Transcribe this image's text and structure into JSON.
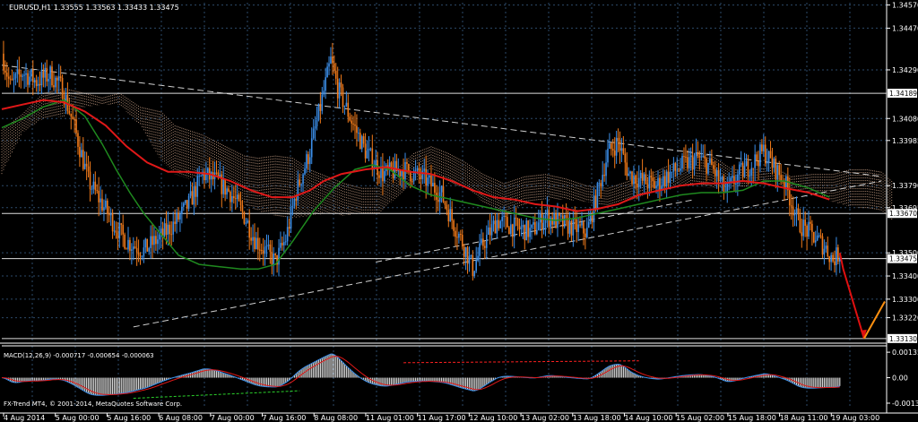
{
  "header": {
    "symbol_line": "EURUSD,H1  1.33555 1.33563 1.33433 1.33475",
    "macd_line": "MACD(12,26,9) -0.000717 -0.000654 -0.000063",
    "copyright": "FX-Trend MT4, © 2001-2014, MetaQuotes Software Corp."
  },
  "colors": {
    "background": "#000000",
    "grid": "#2c4a6a",
    "bull_candle": "#3b8ee8",
    "bear_candle": "#f07a1a",
    "ma_red": "#e01818",
    "ma_green": "#1f8a1f",
    "cloud": "#d2a88c",
    "trendline": "#cfcfcf",
    "forecast_down": "#e01010",
    "forecast_up": "#ff9010"
  },
  "chart_data": {
    "type": "candlestick",
    "symbol": "EURUSD",
    "timeframe": "H1",
    "ohlc_last": {
      "open": 1.33555,
      "high": 1.33563,
      "low": 1.33433,
      "close": 1.33475
    },
    "price_axis": {
      "range": [
        1.3311,
        1.3458
      ],
      "ticks": [
        "1.34570",
        "1.34470",
        "1.34290",
        "1.34080",
        "1.33985",
        "1.33790",
        "1.33695",
        "1.33500",
        "1.33400",
        "1.33300",
        "1.33220"
      ],
      "tick_values": [
        1.3457,
        1.3447,
        1.3429,
        1.3408,
        1.33985,
        1.3379,
        1.33695,
        1.335,
        1.334,
        1.333,
        1.3322
      ]
    },
    "price_labels": [
      {
        "label": "1.34189",
        "value": 1.34189
      },
      {
        "label": "1.33670",
        "value": 1.3367
      },
      {
        "label": "1.33475",
        "value": 1.33475
      },
      {
        "label": "1.33130",
        "value": 1.3313
      }
    ],
    "time_axis": {
      "labels": [
        "4 Aug 2014",
        "5 Aug 00:00",
        "5 Aug 16:00",
        "6 Aug 08:00",
        "7 Aug 00:00",
        "7 Aug 16:00",
        "8 Aug 08:00",
        "11 Aug 01:00",
        "11 Aug 17:00",
        "12 Aug 10:00",
        "13 Aug 02:00",
        "13 Aug 18:00",
        "14 Aug 10:00",
        "15 Aug 02:00",
        "15 Aug 18:00",
        "18 Aug 11:00",
        "19 Aug 03:00"
      ]
    },
    "price_path": [
      [
        0,
        1.3436
      ],
      [
        5,
        1.3422
      ],
      [
        12,
        1.3428
      ],
      [
        20,
        1.3424
      ],
      [
        28,
        1.3427
      ],
      [
        35,
        1.3421
      ],
      [
        42,
        1.3404
      ],
      [
        50,
        1.3381
      ],
      [
        58,
        1.3371
      ],
      [
        66,
        1.3361
      ],
      [
        72,
        1.3355
      ],
      [
        82,
        1.3351
      ],
      [
        92,
        1.3357
      ],
      [
        100,
        1.3363
      ],
      [
        108,
        1.3371
      ],
      [
        116,
        1.3384
      ],
      [
        124,
        1.3381
      ],
      [
        132,
        1.3376
      ],
      [
        140,
        1.3366
      ],
      [
        146,
        1.3356
      ],
      [
        152,
        1.3351
      ],
      [
        158,
        1.3346
      ],
      [
        164,
        1.3356
      ],
      [
        170,
        1.3376
      ],
      [
        178,
        1.3394
      ],
      [
        184,
        1.3413
      ],
      [
        190,
        1.3433
      ],
      [
        194,
        1.3421
      ],
      [
        202,
        1.3407
      ],
      [
        210,
        1.3394
      ],
      [
        220,
        1.3384
      ],
      [
        232,
        1.3386
      ],
      [
        244,
        1.3382
      ],
      [
        254,
        1.3375
      ],
      [
        262,
        1.3361
      ],
      [
        268,
        1.3351
      ],
      [
        272,
        1.3343
      ],
      [
        278,
        1.3354
      ],
      [
        286,
        1.3364
      ],
      [
        296,
        1.3361
      ],
      [
        306,
        1.3359
      ],
      [
        314,
        1.3366
      ],
      [
        322,
        1.3363
      ],
      [
        330,
        1.3361
      ],
      [
        338,
        1.3359
      ],
      [
        344,
        1.3376
      ],
      [
        350,
        1.3393
      ],
      [
        356,
        1.3398
      ],
      [
        362,
        1.3384
      ],
      [
        370,
        1.3381
      ],
      [
        378,
        1.3379
      ],
      [
        386,
        1.3384
      ],
      [
        394,
        1.3388
      ],
      [
        402,
        1.3391
      ],
      [
        410,
        1.3387
      ],
      [
        418,
        1.3376
      ],
      [
        426,
        1.3384
      ],
      [
        434,
        1.3389
      ],
      [
        440,
        1.3394
      ],
      [
        446,
        1.3387
      ],
      [
        452,
        1.3381
      ],
      [
        460,
        1.3363
      ],
      [
        466,
        1.3359
      ],
      [
        472,
        1.3355
      ],
      [
        476,
        1.3352
      ],
      [
        480,
        1.3347
      ],
      [
        484,
        1.335
      ]
    ],
    "ma_red": [
      [
        0,
        1.3412
      ],
      [
        12,
        1.3414
      ],
      [
        24,
        1.3416
      ],
      [
        36,
        1.3415
      ],
      [
        48,
        1.3411
      ],
      [
        60,
        1.3405
      ],
      [
        72,
        1.3396
      ],
      [
        84,
        1.3389
      ],
      [
        96,
        1.3385
      ],
      [
        108,
        1.3385
      ],
      [
        120,
        1.3384
      ],
      [
        132,
        1.3381
      ],
      [
        144,
        1.3377
      ],
      [
        156,
        1.3374
      ],
      [
        168,
        1.3374
      ],
      [
        178,
        1.3377
      ],
      [
        186,
        1.3381
      ],
      [
        196,
        1.3384
      ],
      [
        210,
        1.3386
      ],
      [
        222,
        1.3387
      ],
      [
        236,
        1.3385
      ],
      [
        248,
        1.3384
      ],
      [
        260,
        1.3381
      ],
      [
        272,
        1.3377
      ],
      [
        284,
        1.3374
      ],
      [
        296,
        1.3373
      ],
      [
        308,
        1.3371
      ],
      [
        320,
        1.337
      ],
      [
        332,
        1.3368
      ],
      [
        344,
        1.3369
      ],
      [
        356,
        1.3371
      ],
      [
        368,
        1.3375
      ],
      [
        380,
        1.3377
      ],
      [
        392,
        1.3379
      ],
      [
        404,
        1.338
      ],
      [
        416,
        1.338
      ],
      [
        428,
        1.3381
      ],
      [
        440,
        1.338
      ],
      [
        452,
        1.3378
      ],
      [
        466,
        1.3376
      ],
      [
        478,
        1.3373
      ]
    ],
    "ma_green": [
      [
        0,
        1.3404
      ],
      [
        12,
        1.3408
      ],
      [
        24,
        1.3413
      ],
      [
        36,
        1.3416
      ],
      [
        48,
        1.3409
      ],
      [
        58,
        1.3397
      ],
      [
        66,
        1.3386
      ],
      [
        74,
        1.3376
      ],
      [
        82,
        1.3367
      ],
      [
        92,
        1.3358
      ],
      [
        102,
        1.3349
      ],
      [
        114,
        1.3345
      ],
      [
        126,
        1.3344
      ],
      [
        138,
        1.3343
      ],
      [
        148,
        1.3343
      ],
      [
        158,
        1.3345
      ],
      [
        168,
        1.3355
      ],
      [
        180,
        1.3368
      ],
      [
        192,
        1.3378
      ],
      [
        204,
        1.3386
      ],
      [
        214,
        1.3388
      ],
      [
        224,
        1.3386
      ],
      [
        236,
        1.3379
      ],
      [
        248,
        1.3375
      ],
      [
        260,
        1.3373
      ],
      [
        272,
        1.3371
      ],
      [
        284,
        1.3369
      ],
      [
        296,
        1.3367
      ],
      [
        308,
        1.3365
      ],
      [
        320,
        1.3364
      ],
      [
        332,
        1.3365
      ],
      [
        344,
        1.3367
      ],
      [
        356,
        1.3369
      ],
      [
        368,
        1.3371
      ],
      [
        380,
        1.3373
      ],
      [
        392,
        1.3375
      ],
      [
        404,
        1.3376
      ],
      [
        416,
        1.3376
      ],
      [
        428,
        1.3377
      ],
      [
        440,
        1.3381
      ],
      [
        452,
        1.3381
      ],
      [
        466,
        1.3378
      ],
      [
        478,
        1.3374
      ]
    ],
    "cloud": [
      [
        0,
        1.3403,
        1.3384
      ],
      [
        12,
        1.341,
        1.3402
      ],
      [
        24,
        1.3419,
        1.3408
      ],
      [
        36,
        1.3421,
        1.3409
      ],
      [
        48,
        1.3419,
        1.3413
      ],
      [
        58,
        1.3417,
        1.3414
      ],
      [
        68,
        1.3419,
        1.3414
      ],
      [
        80,
        1.3413,
        1.3405
      ],
      [
        92,
        1.3411,
        1.339
      ],
      [
        100,
        1.3405,
        1.3384
      ],
      [
        108,
        1.3403,
        1.3382
      ],
      [
        116,
        1.3401,
        1.3384
      ],
      [
        124,
        1.3398,
        1.3386
      ],
      [
        132,
        1.3395,
        1.3378
      ],
      [
        140,
        1.3392,
        1.3371
      ],
      [
        148,
        1.3391,
        1.3368
      ],
      [
        158,
        1.3392,
        1.3366
      ],
      [
        168,
        1.3391,
        1.3365
      ],
      [
        178,
        1.3386,
        1.3366
      ],
      [
        188,
        1.3383,
        1.3367
      ],
      [
        198,
        1.338,
        1.3366
      ],
      [
        208,
        1.3378,
        1.3367
      ],
      [
        218,
        1.3378,
        1.3367
      ],
      [
        228,
        1.3386,
        1.3374
      ],
      [
        238,
        1.3393,
        1.338
      ],
      [
        248,
        1.3396,
        1.3386
      ],
      [
        258,
        1.3393,
        1.338
      ],
      [
        268,
        1.3389,
        1.3378
      ],
      [
        278,
        1.3384,
        1.3372
      ],
      [
        290,
        1.338,
        1.3366
      ],
      [
        302,
        1.3383,
        1.3371
      ],
      [
        314,
        1.3384,
        1.3373
      ],
      [
        326,
        1.3382,
        1.3373
      ],
      [
        338,
        1.3379,
        1.3372
      ],
      [
        350,
        1.3378,
        1.337
      ],
      [
        362,
        1.3381,
        1.3372
      ],
      [
        374,
        1.3384,
        1.3376
      ],
      [
        386,
        1.3388,
        1.3379
      ],
      [
        398,
        1.3393,
        1.3379
      ],
      [
        410,
        1.3392,
        1.3378
      ],
      [
        422,
        1.3386,
        1.3378
      ],
      [
        434,
        1.3386,
        1.3379
      ],
      [
        446,
        1.3387,
        1.338
      ],
      [
        456,
        1.3383,
        1.3378
      ],
      [
        468,
        1.3384,
        1.3376
      ],
      [
        480,
        1.3384,
        1.3372
      ],
      [
        490,
        1.3386,
        1.337
      ],
      [
        500,
        1.3386,
        1.3369
      ],
      [
        508,
        1.3385,
        1.3368
      ],
      [
        514,
        1.3381,
        1.3364
      ]
    ],
    "trendlines": [
      {
        "from": [
          0,
          1.3431
        ],
        "to": [
          508,
          1.3383
        ],
        "style": "dashed",
        "color": "#cfcfcf"
      },
      {
        "from": [
          76,
          1.3318
        ],
        "to": [
          508,
          1.3381
        ],
        "style": "dashed",
        "color": "#cfcfcf"
      },
      {
        "from": [
          216,
          1.3346
        ],
        "to": [
          400,
          1.3373
        ],
        "style": "dashed",
        "color": "#cfcfcf"
      }
    ],
    "horizontal_lines": [
      1.34189,
      1.3367,
      1.33475,
      1.3313
    ],
    "forecast_arrows": [
      {
        "from": [
          484,
          1.335
        ],
        "via": [
          486,
          1.3343
        ],
        "to": [
          498,
          1.3313
        ],
        "color": "#e01010"
      },
      {
        "from": [
          498,
          1.3313
        ],
        "to": [
          510,
          1.3329
        ],
        "color": "#ff9010"
      }
    ],
    "macd": {
      "label": "MACD(12,26,9)",
      "main": -0.000717,
      "signal": -0.000654,
      "histogram": -6.3e-05,
      "ticks": [
        "0.001352",
        "0.00",
        "-0.001352"
      ],
      "range": [
        -0.0016,
        0.0017
      ]
    }
  }
}
